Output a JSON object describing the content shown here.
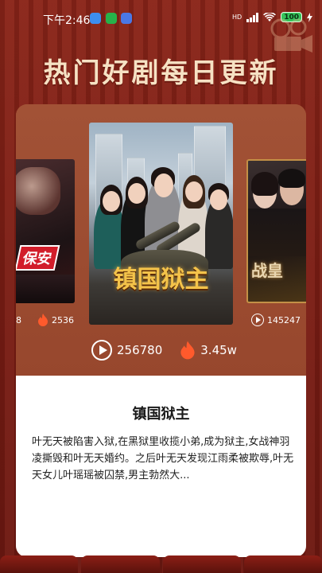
{
  "status_bar": {
    "time": "下午2:46",
    "network": "HD",
    "battery": "100"
  },
  "headline": "热门好剧每日更新",
  "posters": {
    "left": {
      "label": "保安",
      "views_partial": "8",
      "likes": "2536"
    },
    "center": {
      "title_art": "镇国狱主"
    },
    "right": {
      "label": "战皇",
      "views": "145247"
    }
  },
  "featured": {
    "views": "256780",
    "likes": "3.45w",
    "title": "镇国狱主",
    "description": "叶无天被陷害入狱,在黑狱里收揽小弟,成为狱主,女战神羽凌撕毁和叶无天婚约。之后叶无天发现江雨柔被欺辱,叶无天女儿叶瑶瑶被囚禁,男主勃然大..."
  },
  "colors": {
    "background": "#7a1f17",
    "headline": "#f6e2c4",
    "card": "#9b4a30",
    "flame": "#ff5a2c",
    "gold": "#f4c34a"
  },
  "icons": [
    "play-icon",
    "flame-icon",
    "wifi-icon",
    "signal-icon",
    "battery-icon",
    "film-reel-icon"
  ]
}
